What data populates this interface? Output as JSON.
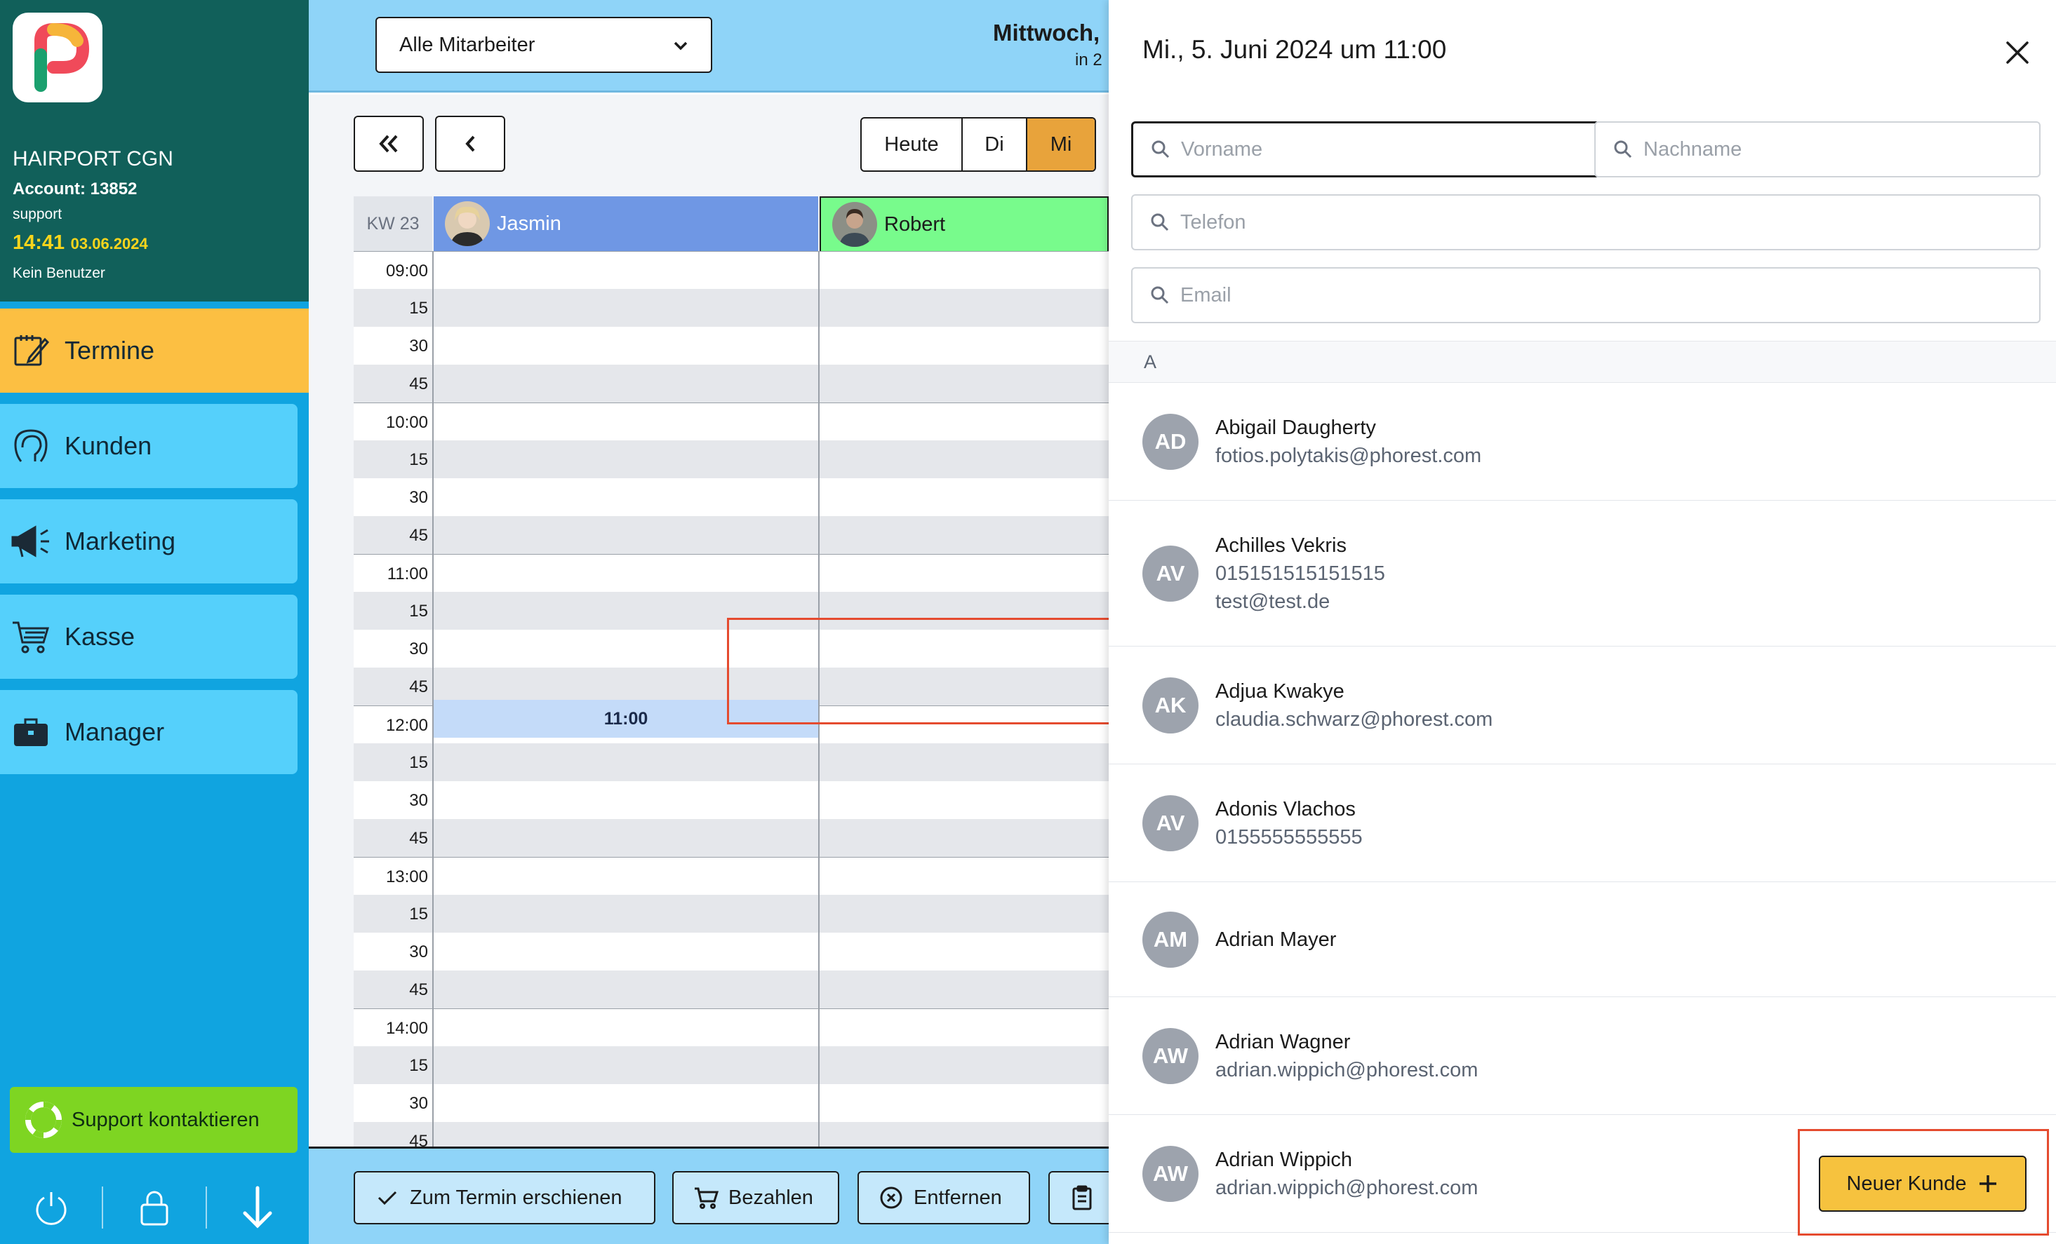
{
  "sidebar": {
    "salon_name": "HAIRPORT CGN",
    "account": "Account: 13852",
    "role": "support",
    "time": "14:41",
    "date": "03.06.2024",
    "user": "Kein Benutzer",
    "nav": [
      {
        "label": "Termine",
        "icon": "calendar-edit-icon"
      },
      {
        "label": "Kunden",
        "icon": "client-head-icon"
      },
      {
        "label": "Marketing",
        "icon": "megaphone-icon"
      },
      {
        "label": "Kasse",
        "icon": "cart-icon"
      },
      {
        "label": "Manager",
        "icon": "briefcase-icon"
      }
    ],
    "support_label": "Support kontaktieren"
  },
  "topbar": {
    "staff_select": "Alle Mitarbeiter",
    "date_title": "Mittwoch,",
    "date_sub": "in 2"
  },
  "calendar": {
    "days": {
      "today": "Heute",
      "tue": "Di",
      "wed": "Mi"
    },
    "week": "KW 23",
    "staff": [
      "Jasmin",
      "Robert"
    ],
    "times": [
      "09:00",
      "15",
      "30",
      "45",
      "10:00",
      "15",
      "30",
      "45",
      "11:00",
      "15",
      "30",
      "45",
      "12:00",
      "15",
      "30",
      "45",
      "13:00",
      "15",
      "30",
      "45",
      "14:00",
      "15",
      "30",
      "45"
    ],
    "selected_slot": "11:00"
  },
  "actions": {
    "arrived": "Zum Termin erschienen",
    "pay": "Bezahlen",
    "remove": "Entfernen"
  },
  "panel": {
    "title": "Mi., 5. Juni 2024 um 11:00",
    "placeholders": {
      "first_name": "Vorname",
      "last_name": "Nachname",
      "phone": "Telefon",
      "email": "Email"
    },
    "letter": "A",
    "clients": [
      {
        "initials": "AD",
        "name": "Abigail Daugherty",
        "lines": [
          "fotios.polytakis@phorest.com"
        ]
      },
      {
        "initials": "AV",
        "name": "Achilles Vekris",
        "lines": [
          "015151515151515",
          "test@test.de"
        ]
      },
      {
        "initials": "AK",
        "name": "Adjua Kwakye",
        "lines": [
          "claudia.schwarz@phorest.com"
        ]
      },
      {
        "initials": "AV",
        "name": "Adonis Vlachos",
        "lines": [
          "0155555555555"
        ]
      },
      {
        "initials": "AM",
        "name": "Adrian Mayer",
        "lines": []
      },
      {
        "initials": "AW",
        "name": "Adrian Wagner",
        "lines": [
          "adrian.wippich@phorest.com"
        ]
      },
      {
        "initials": "AW",
        "name": "Adrian Wippich",
        "lines": [
          "adrian.wippich@phorest.com"
        ]
      }
    ],
    "new_client": "Neuer Kunde"
  },
  "colors": {
    "sidebar_top": "#11605a",
    "sidebar": "#10a4e0",
    "nav_item": "#55d0fb",
    "nav_active": "#fcbf42",
    "selected_day": "#e8a33b",
    "staff_jasmin": "#6f97e4",
    "staff_robert": "#78fb8c",
    "primary_button": "#f6c23e",
    "highlight": "#e54b2f"
  }
}
